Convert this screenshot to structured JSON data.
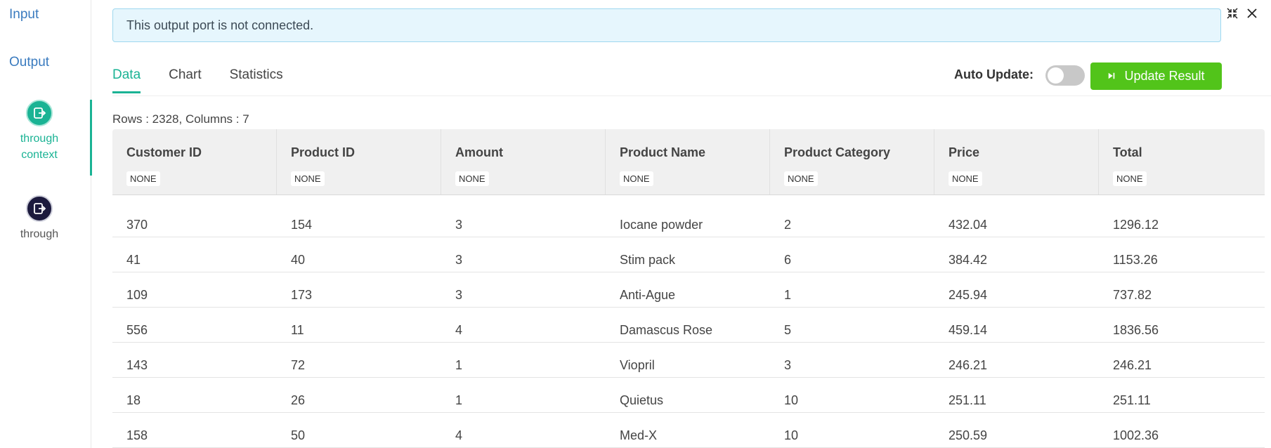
{
  "sidebar": {
    "input_label": "Input",
    "output_label": "Output",
    "nodes": [
      {
        "label_line1": "through",
        "label_line2": "context"
      },
      {
        "label_line1": "through"
      }
    ]
  },
  "alert": {
    "text": "This output port is not connected."
  },
  "tabs": [
    {
      "label": "Data"
    },
    {
      "label": "Chart"
    },
    {
      "label": "Statistics"
    }
  ],
  "toolbar": {
    "auto_update_label": "Auto Update:",
    "update_button_label": "Update Result"
  },
  "rows_info": "Rows : 2328, Columns : 7",
  "table": {
    "columns": [
      {
        "title": "Customer ID",
        "tag": "NONE"
      },
      {
        "title": "Product ID",
        "tag": "NONE"
      },
      {
        "title": "Amount",
        "tag": "NONE"
      },
      {
        "title": "Product Name",
        "tag": "NONE"
      },
      {
        "title": "Product Category",
        "tag": "NONE"
      },
      {
        "title": "Price",
        "tag": "NONE"
      },
      {
        "title": "Total",
        "tag": "NONE"
      }
    ],
    "rows": [
      [
        "370",
        "154",
        "3",
        "Iocane powder",
        "2",
        "432.04",
        "1296.12"
      ],
      [
        "41",
        "40",
        "3",
        "Stim pack",
        "6",
        "384.42",
        "1153.26"
      ],
      [
        "109",
        "173",
        "3",
        "Anti-Ague",
        "1",
        "245.94",
        "737.82"
      ],
      [
        "556",
        "11",
        "4",
        "Damascus Rose",
        "5",
        "459.14",
        "1836.56"
      ],
      [
        "143",
        "72",
        "1",
        "Viopril",
        "3",
        "246.21",
        "246.21"
      ],
      [
        "18",
        "26",
        "1",
        "Quietus",
        "10",
        "251.11",
        "251.11"
      ],
      [
        "158",
        "50",
        "4",
        "Med-X",
        "10",
        "250.59",
        "1002.36"
      ]
    ]
  },
  "colors": {
    "accent": "#1ab394",
    "button": "#52c41a",
    "link": "#3a7bbf",
    "alert_bg": "#e6f6fd"
  }
}
